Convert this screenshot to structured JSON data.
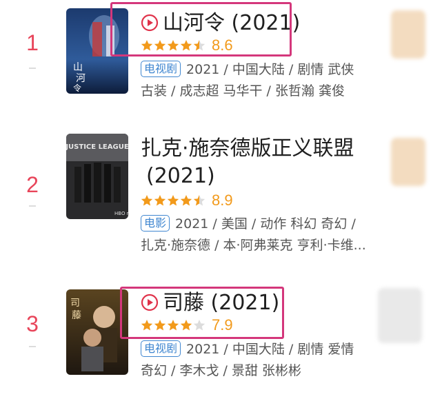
{
  "items": [
    {
      "rank": "1",
      "title": "山河令 (2021)",
      "has_play": true,
      "rating": 4.5,
      "score": "8.6",
      "tag": "电视剧",
      "meta_line1": "2021 / 中国大陆 / 剧情 武侠",
      "meta_line2": "古装 / 成志超 马华干 / 张哲瀚 龚俊"
    },
    {
      "rank": "2",
      "title_line1": "扎克·施奈德版正义联盟",
      "title_line2": "(2021)",
      "has_play": false,
      "rating": 4.5,
      "score": "8.9",
      "tag": "电影",
      "meta_line1": "2021 / 美国 / 动作 科幻 奇幻 /",
      "meta_line2": "扎克·施奈德 / 本·阿弗莱克 亨利·卡维..."
    },
    {
      "rank": "3",
      "title": "司藤 (2021)",
      "has_play": true,
      "rating": 4.0,
      "score": "7.9",
      "tag": "电视剧",
      "meta_line1": "2021 / 中国大陆 / 剧情 爱情",
      "meta_line2": "奇幻 / 李木戈 / 景甜 张彬彬"
    }
  ],
  "colors": {
    "rank": "#e8455a",
    "star": "#f29a1b",
    "tag": "#3f86d0",
    "highlight": "#d4377b"
  }
}
